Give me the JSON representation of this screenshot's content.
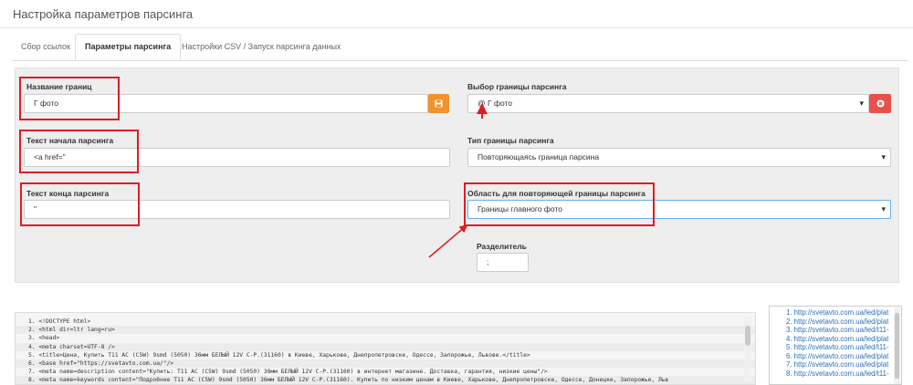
{
  "page": {
    "title": "Настройка параметров парсинга"
  },
  "tabs": [
    {
      "label": "Сбор ссылок"
    },
    {
      "label": "Параметры парсинга"
    },
    {
      "label": "Настройки CSV / Запуск парсинга данных"
    }
  ],
  "form": {
    "boundary_name": {
      "label": "Название границ",
      "value": "Г фото"
    },
    "start_text": {
      "label": "Текст начала парсинга",
      "value": "<a href=\""
    },
    "end_text": {
      "label": "Текст конца парсинга",
      "value": "\""
    },
    "boundary_select": {
      "label": "Выбор границы парсинга",
      "value": "@ Г фото"
    },
    "boundary_type": {
      "label": "Тип границы парсинга",
      "value": "Повторяющаясь граница парсина"
    },
    "repeat_area": {
      "label": "Область для повторяющей границы парсинга",
      "value": "Границы главного фото"
    },
    "separator": {
      "label": "Разделитель",
      "value": ";"
    }
  },
  "icons": {
    "save": "save-icon",
    "remove": "close-circle-icon"
  },
  "colors": {
    "save_button": "#f0932b",
    "remove_button": "#e9504a",
    "highlight": "#e01b23",
    "link": "#2a6fbb"
  },
  "code_lines": [
    "1. <!DOCTYPE html>",
    "2. <html dir=ltr lang=ru>",
    "3. <head>",
    "4. <meta charset=UTF-8 />",
    "5. <title>Цена, Купить T11 AC (C5W) 9smd (5050) 36мм БЕЛЫЙ 12V C-P.(31160) в Киеве, Харькове, Днепропетровске, Одессе, Запорожье, Львове.</title>",
    "6. <base href=\"https://svetavto.com.ua/\"/>",
    "7. <meta name=description content=\"Купить: T11 AC (C5W) 9smd (5050) 36мм БЕЛЫЙ 12V C-P.(31160) в интернет магазине. Доставка, гарантия, низкие цены\"/>",
    "8. <meta name=keywords content=\"Подробнее T11 AC (C5W) 9smd (5050) 36мм БЕЛЫЙ 12V C-P.(31160). Купить по низким ценам в Киеве, Харькове, Днепропетровске, Одессе, Донецке, Запорожье, Льв"
  ],
  "links": [
    "1. http://svetavto.com.ua/led/plat",
    "2. http://svetavto.com.ua/led/plat",
    "3. http://svetavto.com.ua/led/t11-",
    "4. http://svetavto.com.ua/led/plat",
    "5. http://svetavto.com.ua/led/t11-",
    "6. http://svetavto.com.ua/led/plat",
    "7. http://svetavto.com.ua/led/plat",
    "8. http://svetavto.com.ua/led/t11-"
  ]
}
